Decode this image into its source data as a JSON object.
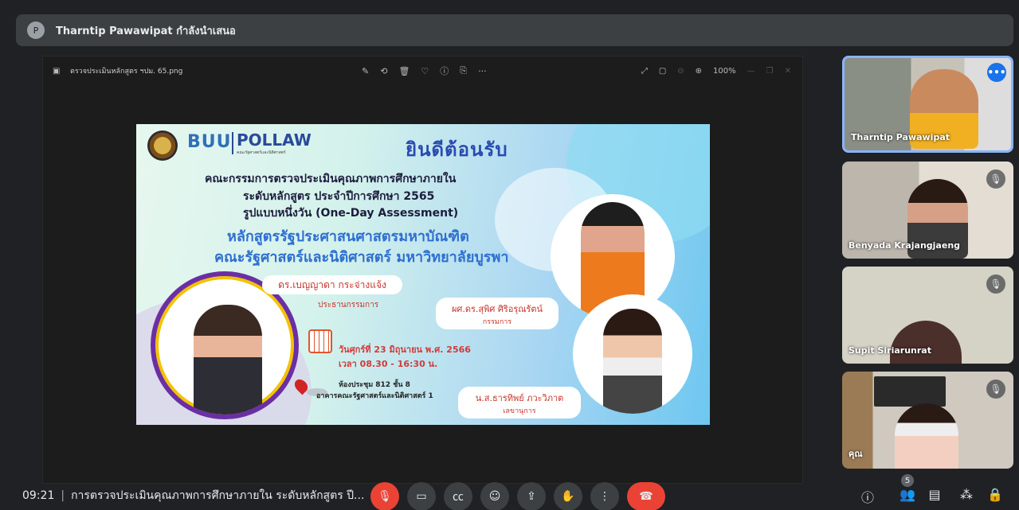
{
  "banner": {
    "avatar": "P",
    "text": "Tharntip Pawawipat กำลังนำเสนอ"
  },
  "viewer": {
    "file_name": "ตรวจประเมินหลักสูตร ฯปม. 65.png",
    "tools": [
      "✎",
      "⟲",
      "🗑",
      "♡",
      "ⓘ",
      "⎘",
      "···"
    ],
    "zoom": "100%"
  },
  "slide": {
    "logo_left": "BUU",
    "logo_right": "POLLAW",
    "logo_sub": "คณะรัฐศาสตร์และนิติศาสตร์",
    "welcome": "ยินดีต้อนรับ",
    "line1": "คณะกรรมการตรวจประเมินคุณภาพการศึกษาภายใน",
    "line2": "ระดับหลักสูตร ประจำปีการศึกษา 2565",
    "line3": "รูปแบบหนึ่งวัน (One-Day Assessment)",
    "line4": "หลักสูตรรัฐประศาสนศาสตรมหาบัณฑิต",
    "line5": "คณะรัฐศาสตร์และนิติศาสตร์ มหาวิทยาลัยบูรพา",
    "person1_name": "ดร.เบญญาดา กระจ่างแจ้ง",
    "person1_role": "ประธานกรรมการ",
    "person2_name": "ผศ.ดร.สุพิศ ศิริอรุณรัตน์",
    "person2_role": "กรรมการ",
    "person3_name": "น.ส.ธารทิพย์ ภวะวิภาต",
    "person3_role": "เลขานุการ",
    "date": "วันศุกร์ที่ 23 มิถุนายน พ.ศ. 2566",
    "time": "เวลา 08.30 - 16:30 น.",
    "room": "ห้องประชุม 812 ชั้น 8",
    "building": "อาคารคณะรัฐศาสตร์และนิติศาสตร์ 1"
  },
  "participants": [
    {
      "name": "Tharntip Pawawipat",
      "muted": false
    },
    {
      "name": "Benyada Krajangjaeng",
      "muted": true
    },
    {
      "name": "Supit Siriarunrat",
      "muted": true
    },
    {
      "name": "คุณ",
      "muted": true
    }
  ],
  "bottom": {
    "time": "09:21",
    "meeting_title": "การตรวจประเมินคุณภาพการศึกษาภายใน ระดับหลักสูตร ปี...",
    "people_count": "5"
  },
  "colors": {
    "end_call": "#ea4335",
    "active_tile_border": "#8ab4f8",
    "background": "#202124"
  }
}
